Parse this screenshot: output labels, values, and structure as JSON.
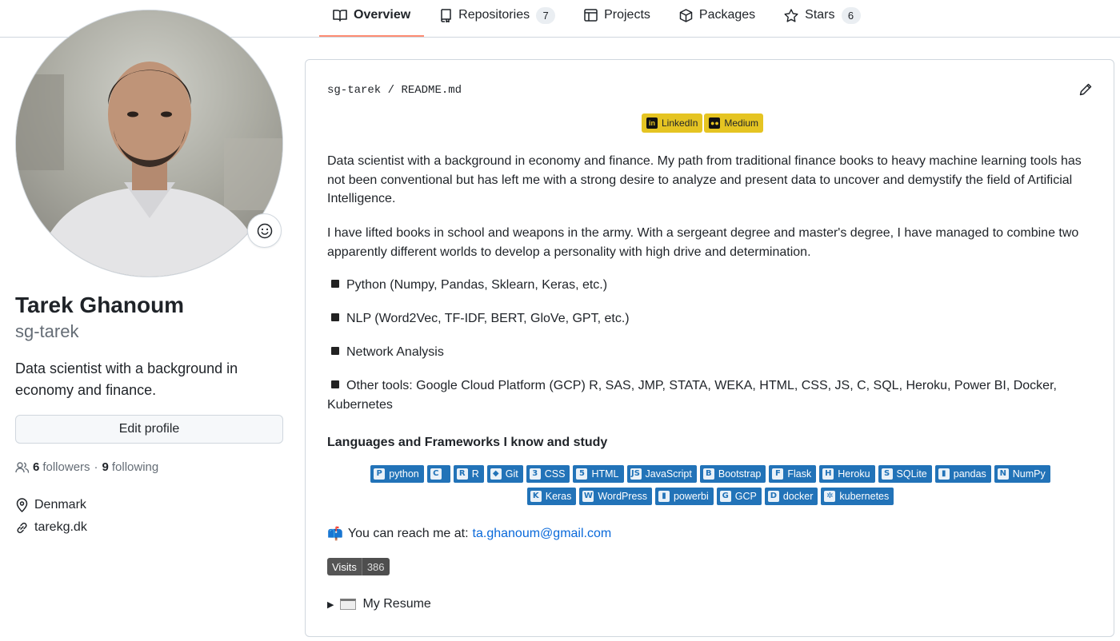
{
  "nav": {
    "tabs": [
      {
        "label": "Overview",
        "icon": "book-icon",
        "active": true
      },
      {
        "label": "Repositories",
        "icon": "repo-icon",
        "count": "7"
      },
      {
        "label": "Projects",
        "icon": "table-icon"
      },
      {
        "label": "Packages",
        "icon": "package-icon"
      },
      {
        "label": "Stars",
        "icon": "star-icon",
        "count": "6"
      }
    ]
  },
  "profile": {
    "full_name": "Tarek Ghanoum",
    "login": "sg-tarek",
    "bio": "Data scientist with a background in economy and finance.",
    "edit_button": "Edit profile",
    "followers_count": "6",
    "followers_label": "followers",
    "separator": "·",
    "following_count": "9",
    "following_label": "following",
    "location": "Denmark",
    "website": "tarekg.dk"
  },
  "readme": {
    "path_owner": "sg-tarek",
    "path_sep": "/",
    "path_file": "README.md",
    "social_badges": [
      {
        "label": "LinkedIn",
        "icon": "linkedin-icon"
      },
      {
        "label": "Medium",
        "icon": "medium-icon"
      }
    ],
    "intro": "Data scientist with a background in economy and finance. My path from traditional finance books to heavy machine learning tools has not been conventional but has left me with a strong desire to analyze and present data to uncover and demystify the field of Artificial Intelligence.",
    "army": "I have lifted books in school and weapons in the army. With a sergeant degree and master's degree, I have managed to combine two apparently different worlds to develop a personality with high drive and determination.",
    "skills": [
      "Python (Numpy, Pandas, Sklearn, Keras, etc.)",
      "NLP (Word2Vec, TF-IDF, BERT, GloVe, GPT, etc.)",
      "Network Analysis",
      "Other tools: Google Cloud Platform (GCP) R, SAS, JMP, STATA, WEKA, HTML, CSS, JS, C, SQL, Heroku, Power BI, Docker, Kubernetes"
    ],
    "languages_title": "Languages and Frameworks I know and study",
    "tech_row1": [
      {
        "label": "python",
        "glyph": "P"
      },
      {
        "label": "",
        "glyph": "C"
      },
      {
        "label": "R",
        "glyph": "R"
      },
      {
        "label": "Git",
        "glyph": "◆"
      },
      {
        "label": "CSS",
        "glyph": "3"
      },
      {
        "label": "HTML",
        "glyph": "5"
      },
      {
        "label": "JavaScript",
        "glyph": "JS"
      },
      {
        "label": "Bootstrap",
        "glyph": "B"
      },
      {
        "label": "Flask",
        "glyph": "F"
      },
      {
        "label": "Heroku",
        "glyph": "H"
      },
      {
        "label": "SQLite",
        "glyph": "S"
      },
      {
        "label": "pandas",
        "glyph": "▮"
      },
      {
        "label": "NumPy",
        "glyph": "N"
      }
    ],
    "tech_row2": [
      {
        "label": "Keras",
        "glyph": "K"
      },
      {
        "label": "WordPress",
        "glyph": "W"
      },
      {
        "label": "powerbi",
        "glyph": "▮"
      },
      {
        "label": "GCP",
        "glyph": "G"
      },
      {
        "label": "docker",
        "glyph": "D"
      },
      {
        "label": "kubernetes",
        "glyph": "✲"
      }
    ],
    "reach_emoji": "📫",
    "reach_text": "You can reach me at:",
    "email": "ta.ghanoum@gmail.com",
    "visits_label": "Visits",
    "visits_count": "386",
    "resume_label": "My Resume"
  },
  "colors": {
    "accent_underline": "#fd8c73",
    "link": "#0969da",
    "badge_blue": "#2273b8",
    "social_yellow": "#e5c422"
  }
}
